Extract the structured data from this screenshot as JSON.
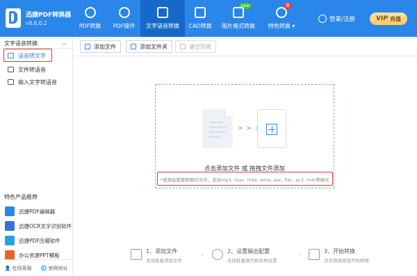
{
  "app": {
    "name": "迅捷PDF转换器",
    "version": "v8.6.0.2"
  },
  "nav": [
    {
      "label": "PDF转换",
      "badge": ""
    },
    {
      "label": "PDF操作",
      "badge": ""
    },
    {
      "label": "文字语音转换",
      "badge": "",
      "active": true
    },
    {
      "label": "CAD转换",
      "badge": ""
    },
    {
      "label": "图片格式转换",
      "badge": "new"
    },
    {
      "label": "特色转换 ▾",
      "badge": "热"
    }
  ],
  "header": {
    "login": "登录/注册",
    "vip_tag": "VIP",
    "vip_label": "充值"
  },
  "sidebar": {
    "title": "文字语音转换",
    "collapse": "︿",
    "items": [
      {
        "label": "语音转文字",
        "active": true
      },
      {
        "label": "文件转语音"
      },
      {
        "label": "输入文字转语音"
      }
    ],
    "recommend_title": "特色产品推荐",
    "recommend": [
      {
        "label": "迅捷PDF编辑器",
        "color": "#2a86e8"
      },
      {
        "label": "迅捷OCR文字识别软件",
        "color": "#3a6fd8"
      },
      {
        "label": "迅捷PDF压缩软件",
        "color": "#2aa0e8"
      },
      {
        "label": "办公资源PPT模板",
        "color": "#e8632a"
      }
    ],
    "bottom": {
      "service": "在线客服",
      "website": "官网地址"
    }
  },
  "toolbar": {
    "add_file": "添加文件",
    "add_folder": "添加文件夹",
    "clear": "清空列表"
  },
  "dropzone": {
    "arrows": "> > >",
    "title": "点击添加文件 或 拖拽文件添加",
    "hint": "*请添加需要转换的文件，支持mp3, mav, m4a, wma, aac, flac, ac3, m4r等格式"
  },
  "steps": [
    {
      "title": "1、添加文件",
      "desc": "支持批量添加文件"
    },
    {
      "title": "2、设置输出配置",
      "desc": "支持批量操作和各种设置"
    },
    {
      "title": "3、开始转换",
      "desc": "点击转换按钮开始转换"
    }
  ],
  "colors": {
    "brand": "#2a86e8",
    "highlight": "#e03434"
  }
}
